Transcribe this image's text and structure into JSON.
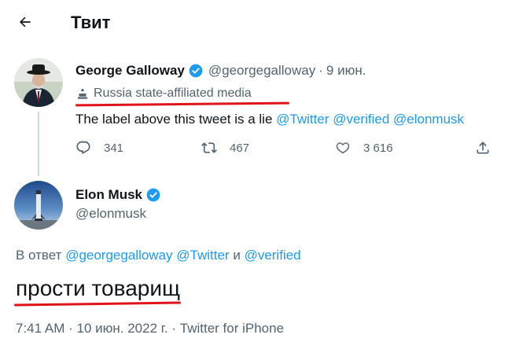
{
  "header": {
    "title": "Твит",
    "back_icon": "arrow-left-icon"
  },
  "tweet1": {
    "author_name": "George Galloway",
    "author_handle": "@georgegalloway",
    "separator": "·",
    "time": "9 июн.",
    "label": "Russia state-affiliated media",
    "label_icon": "podium-icon",
    "text": "The label above this tweet is a lie",
    "mentions": [
      "@Twitter",
      "@verified",
      "@elonmusk"
    ],
    "stats": {
      "replies": "341",
      "retweets": "467",
      "likes": "3 616"
    }
  },
  "tweet2": {
    "author_name": "Elon Musk",
    "author_handle": "@elonmusk",
    "reply_prefix": "В ответ",
    "reply_mentions": [
      "@georgegalloway",
      "@Twitter",
      "@verified"
    ],
    "reply_conj": "и",
    "text": "прости товарищ",
    "timestamp": "7:41 AM",
    "date": "10 июн. 2022 г.",
    "source": "Twitter for iPhone"
  },
  "colors": {
    "accent": "#1d9bf0",
    "secondary_text": "#536471",
    "annotation_red": "#e0131a"
  }
}
